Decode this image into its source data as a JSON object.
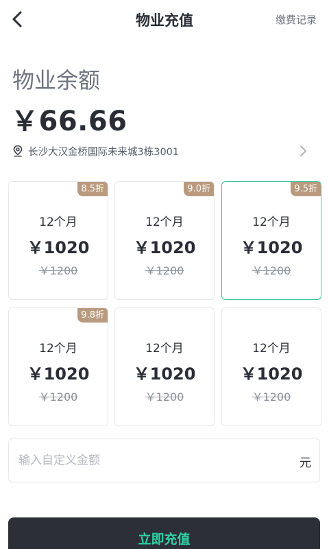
{
  "nav": {
    "title": "物业充值",
    "history_label": "缴费记录",
    "back_icon": "chevron-left-icon"
  },
  "balance": {
    "label": "物业余额",
    "amount": "￥66.66"
  },
  "address": {
    "icon": "location-pin-icon",
    "text": "长沙大汉金桥国际未来城3栋3001",
    "chevron_icon": "chevron-right-icon"
  },
  "plans": [
    {
      "badge": "8.5折",
      "months": "12个月",
      "price": "￥1020",
      "original": "￥1200",
      "selected": false
    },
    {
      "badge": "9.0折",
      "months": "12个月",
      "price": "￥1020",
      "original": "￥1200",
      "selected": false
    },
    {
      "badge": "9.5折",
      "months": "12个月",
      "price": "￥1020",
      "original": "￥1200",
      "selected": true
    },
    {
      "badge": "9.8折",
      "months": "12个月",
      "price": "￥1020",
      "original": "￥1200",
      "selected": false
    },
    {
      "badge": "",
      "months": "12个月",
      "price": "￥1020",
      "original": "￥1200",
      "selected": false
    },
    {
      "badge": "",
      "months": "12个月",
      "price": "￥1020",
      "original": "￥1200",
      "selected": false
    }
  ],
  "custom_amount": {
    "placeholder": "输入自定义金额",
    "value": "",
    "unit": "元"
  },
  "submit_label": "立即充值",
  "colors": {
    "accent": "#35c79b",
    "badge": "#b99a7e",
    "button_bg": "#2c2f38",
    "button_text": "#2fd3a3"
  }
}
